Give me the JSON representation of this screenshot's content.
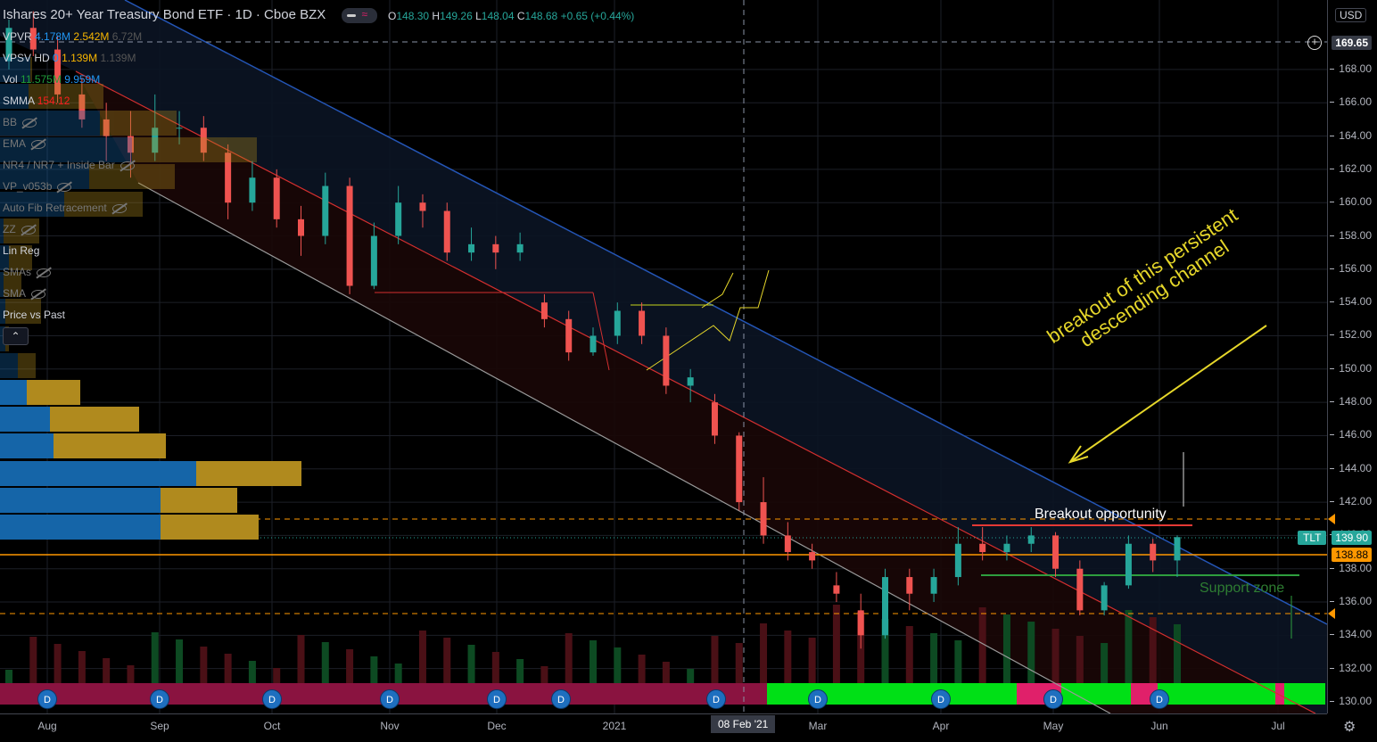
{
  "header": {
    "title": "Ishares 20+ Year Treasury Bond ETF · 1D · Cboe BZX",
    "ohlc": {
      "o_label": "O",
      "o": "148.30",
      "h_label": "H",
      "h": "149.26",
      "l_label": "L",
      "l": "148.04",
      "c_label": "C",
      "c": "148.68",
      "change": "+0.65 (+0.44%)"
    }
  },
  "indicators": [
    {
      "name": "VPVR",
      "v1": "4.178M",
      "v2": "2.542M",
      "v3": "6.72M",
      "visible": true
    },
    {
      "name": "VPSV HD",
      "v1": "0",
      "v2": "1.139M",
      "v3": "1.139M",
      "visible": true
    },
    {
      "name": "Vol",
      "v1": "11.575M",
      "v2": "9.959M",
      "visible": true
    },
    {
      "name": "SMMA",
      "v1": "154.12",
      "visible": true
    },
    {
      "name": "BB",
      "visible": false
    },
    {
      "name": "EMA",
      "visible": false
    },
    {
      "name": "NR4 / NR7 + Inside Bar",
      "visible": false
    },
    {
      "name": "VP_v053b",
      "visible": false
    },
    {
      "name": "Auto Fib Retracement",
      "visible": false
    },
    {
      "name": "ZZ",
      "visible": false
    },
    {
      "name": "Lin Reg",
      "visible": true
    },
    {
      "name": "SMAs",
      "visible": false
    },
    {
      "name": "SMA",
      "visible": false
    },
    {
      "name": "Price vs Past",
      "visible": true
    }
  ],
  "axis": {
    "currency": "USD",
    "crosshair_price": "169.65",
    "symbol": "TLT",
    "last_price": "139.90",
    "line_price": "138.88",
    "crosshair_date": "08 Feb '21"
  },
  "annotations": {
    "breakout_text_1": "breakout of this persistent",
    "breakout_text_2": "descending channel",
    "breakout_opportunity": "Breakout opportunity",
    "support_zone": "Support zone"
  },
  "dividend_marker": "D",
  "colors": {
    "up": "#26a69a",
    "down": "#ef5350",
    "channel": "#1e4fa8",
    "lower": "#c62828",
    "accent": "#ff9800",
    "note": "#e6d72a"
  },
  "chart_data": {
    "type": "candlestick",
    "title": "Ishares 20+ Year Treasury Bond ETF · 1D · Cboe BZX",
    "ylim": [
      130,
      172
    ],
    "yticks": [
      130,
      132,
      134,
      136,
      138,
      140,
      142,
      144,
      146,
      148,
      150,
      152,
      154,
      156,
      158,
      160,
      162,
      164,
      166,
      168
    ],
    "xticks": [
      "Aug",
      "Sep",
      "Oct",
      "Nov",
      "Dec",
      "2021",
      "Mar",
      "Apr",
      "May",
      "Jun",
      "Jul"
    ],
    "dividend_dates": [
      "Aug",
      "Sep",
      "Oct",
      "Nov",
      "Dec",
      "Dec-mid",
      "Feb",
      "Mar",
      "Apr",
      "May",
      "Jun"
    ],
    "candles": [
      [
        168.5,
        171,
        168,
        170.5
      ],
      [
        170.5,
        171.5,
        168.8,
        169.2
      ],
      [
        169.2,
        170,
        166,
        166.5
      ],
      [
        166.5,
        167.5,
        164.5,
        165
      ],
      [
        165,
        166,
        162.5,
        164
      ],
      [
        164,
        165.5,
        161.5,
        163
      ],
      [
        163,
        166.5,
        162.5,
        164.5
      ],
      [
        164.5,
        165.5,
        163.5,
        164.5
      ],
      [
        164.5,
        165.2,
        162.5,
        163
      ],
      [
        163,
        163.5,
        159,
        160
      ],
      [
        160,
        162.5,
        159.5,
        161.5
      ],
      [
        161.5,
        162,
        158.5,
        159
      ],
      [
        159,
        159.8,
        156.8,
        158
      ],
      [
        158,
        161.8,
        157.5,
        161
      ],
      [
        161,
        161.5,
        154.5,
        155
      ],
      [
        155,
        158.8,
        154.8,
        158
      ],
      [
        158,
        161,
        157.5,
        160
      ],
      [
        160,
        160.5,
        158.5,
        159.5
      ],
      [
        159.5,
        160,
        156.5,
        157
      ],
      [
        157,
        158.5,
        156.5,
        157.5
      ],
      [
        157.5,
        158,
        156,
        157
      ],
      [
        157,
        158.2,
        156.5,
        157.5
      ],
      [
        154,
        154.5,
        152.5,
        153
      ],
      [
        153,
        153.5,
        150.5,
        151
      ],
      [
        151,
        152.5,
        150.8,
        152
      ],
      [
        152,
        154,
        151.5,
        153.5
      ],
      [
        153.5,
        154,
        151.5,
        152
      ],
      [
        152,
        152.5,
        148.5,
        149
      ],
      [
        149,
        150,
        148,
        149.5
      ],
      [
        148,
        148.5,
        145.5,
        146
      ],
      [
        146,
        146.2,
        141.5,
        142
      ],
      [
        142,
        143.5,
        139.5,
        140
      ],
      [
        140,
        140.8,
        138.5,
        139
      ],
      [
        139,
        139.5,
        138,
        138.5
      ],
      [
        137,
        137.8,
        136,
        136.5
      ],
      [
        135.5,
        136.5,
        133.2,
        134
      ],
      [
        134,
        138,
        133.8,
        137.5
      ],
      [
        137.5,
        138,
        135.5,
        136.5
      ],
      [
        136.5,
        138,
        136,
        137.5
      ],
      [
        137.5,
        140.5,
        137,
        139.5
      ],
      [
        139.5,
        140.5,
        138.5,
        139
      ],
      [
        139,
        140,
        138.5,
        139.5
      ],
      [
        139.5,
        140.5,
        139,
        140
      ],
      [
        140,
        140.2,
        137.5,
        138
      ],
      [
        138,
        138.5,
        135.2,
        135.5
      ],
      [
        135.5,
        137.2,
        135.2,
        137
      ],
      [
        137,
        140,
        136.8,
        139.5
      ],
      [
        139.5,
        139.8,
        137.8,
        138.5
      ],
      [
        138.5,
        140,
        137.5,
        139.9
      ]
    ],
    "volume_profile": [
      {
        "up": 0.9,
        "down": 0.55
      },
      {
        "up": 0.9,
        "down": 0.43
      },
      {
        "up": 1.1,
        "down": 0.59
      },
      {
        "up": 0.3,
        "down": 0.63
      },
      {
        "up": 0.28,
        "down": 0.5
      },
      {
        "up": 0.15,
        "down": 0.3
      },
      {
        "up": 0.1,
        "down": 0.1
      },
      {
        "up": 0.03,
        "down": 0.02
      },
      {
        "up": 0.03,
        "down": 0.2
      },
      {
        "up": 0.02,
        "down": 0.1
      },
      {
        "up": 0.05,
        "down": 0.13
      },
      {
        "up": 0.02,
        "down": 0.2
      },
      {
        "up": 0.36,
        "down": 0.44
      },
      {
        "up": 0.5,
        "down": 0.48
      },
      {
        "up": 0.74,
        "down": 0.7
      },
      {
        "up": 0.56,
        "down": 0.43
      },
      {
        "up": 0.16,
        "down": 0.42
      },
      {
        "up": 0.17,
        "down": 0.01
      }
    ]
  }
}
